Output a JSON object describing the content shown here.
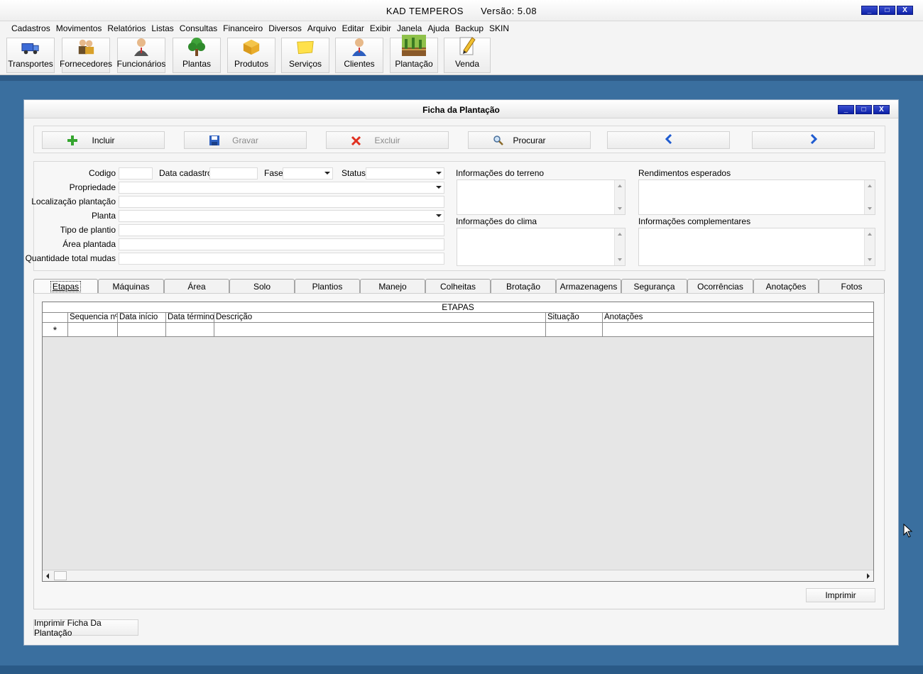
{
  "app": {
    "title": "KAD TEMPEROS",
    "version": "Versão: 5.08",
    "window_buttons": [
      "_",
      "□",
      "X"
    ]
  },
  "menu": [
    "Cadastros",
    "Movimentos",
    "Relatórios",
    "Listas",
    "Consultas",
    "Financeiro",
    "Diversos",
    "Arquivo",
    "Editar",
    "Exibir",
    "Janela",
    "Ajuda",
    "Backup",
    "SKIN"
  ],
  "toolbar": [
    {
      "label": "Transportes",
      "icon": "truck-icon"
    },
    {
      "label": "Fornecedores",
      "icon": "suppliers-icon"
    },
    {
      "label": "Funcionários",
      "icon": "employee-icon"
    },
    {
      "label": "Plantas",
      "icon": "tree-icon"
    },
    {
      "label": "Produtos",
      "icon": "box-icon"
    },
    {
      "label": "Serviços",
      "icon": "note-icon"
    },
    {
      "label": "Clientes",
      "icon": "client-icon"
    },
    {
      "label": "Plantação",
      "icon": "plantation-icon"
    },
    {
      "label": "Venda",
      "icon": "sale-pencil-icon"
    }
  ],
  "child": {
    "title": "Ficha da Plantação",
    "actions": {
      "incluir": "Incluir",
      "gravar": "Gravar",
      "excluir": "Excluir",
      "procurar": "Procurar"
    },
    "form": {
      "codigo_label": "Codigo",
      "data_cadastro_label": "Data cadastro",
      "fase_label": "Fase",
      "status_label": "Status",
      "propriedade_label": "Propriedade",
      "localizacao_label": "Localização plantação",
      "planta_label": "Planta",
      "tipo_plantio_label": "Tipo de plantio",
      "area_plantada_label": "Área plantada",
      "quantidade_label": "Quantidade total mudas",
      "info_terreno_label": "Informações do terreno",
      "rendimentos_label": "Rendimentos esperados",
      "info_clima_label": "Informações do clima",
      "info_complementares_label": "Informações complementares"
    },
    "tabs": [
      "Etapas",
      "Máquinas",
      "Área",
      "Solo",
      "Plantios",
      "Manejo",
      "Colheitas",
      "Brotação",
      "Armazenagens",
      "Segurança",
      "Ocorrências",
      "Anotações",
      "Fotos"
    ],
    "active_tab": "Etapas",
    "grid": {
      "caption": "ETAPAS",
      "columns": [
        "Sequencia nº",
        "Data início",
        "Data término",
        "Descrição",
        "Situação",
        "Anotações"
      ],
      "new_row_marker": "*"
    },
    "imprimir": "Imprimir",
    "imprimir_ficha": "Imprimir Ficha Da Plantação"
  }
}
